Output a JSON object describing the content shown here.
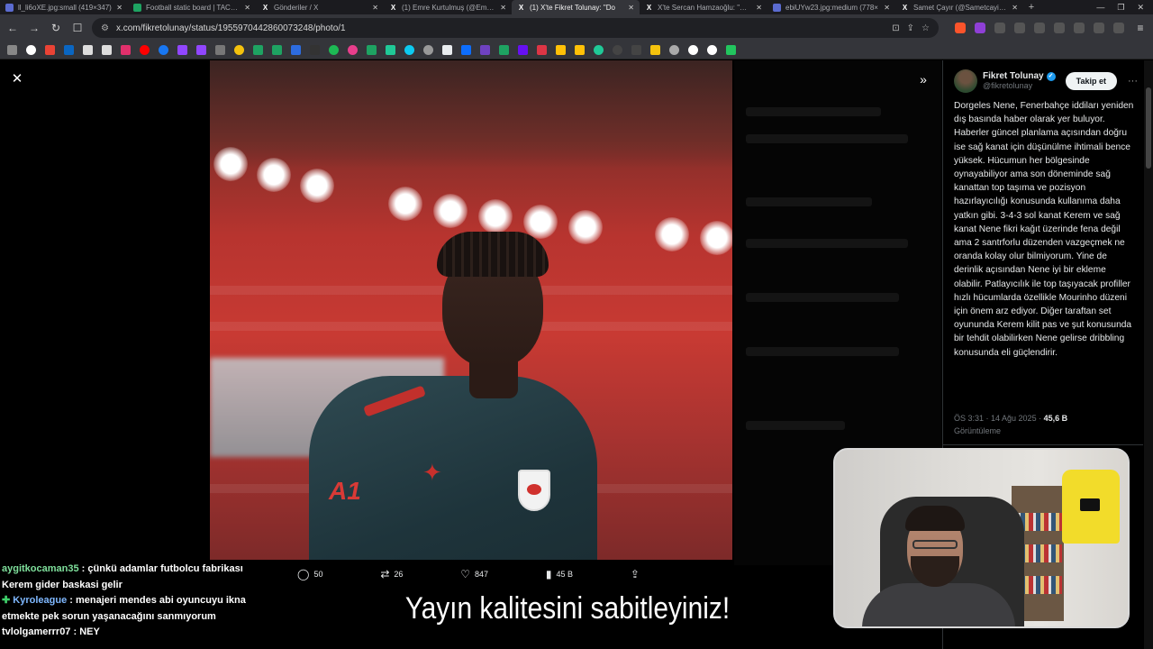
{
  "browser": {
    "tabs": [
      {
        "title": "ll_li6oXE.jpg:small (419×347)",
        "favicon": "img",
        "active": false
      },
      {
        "title": "Football static board | TACTIC",
        "favicon": "green",
        "active": false
      },
      {
        "title": "Gönderiler / X",
        "favicon": "x",
        "active": false
      },
      {
        "title": "(1) Emre Kurtulmuş (@Emrell",
        "favicon": "x",
        "active": false
      },
      {
        "title": "(1) X'te Fikret Tolunay: \"Do",
        "favicon": "x",
        "active": true
      },
      {
        "title": "X'te Sercan Hamzaoğlu: \"ÖZE",
        "favicon": "x",
        "active": false
      },
      {
        "title": "ebiUYw23.jpg:medium (778×",
        "favicon": "img",
        "active": false
      },
      {
        "title": "Samet Çayır (@Sametcayir) / X",
        "favicon": "x",
        "active": false
      }
    ],
    "new_tab": "+",
    "url": "x.com/fikretolunay/status/1955970442860073248/photo/1"
  },
  "viewer": {
    "close_label": "✕",
    "expand_label": "»",
    "actions": {
      "replies": "50",
      "reposts": "26",
      "likes": "847",
      "views": "45 B"
    }
  },
  "tweet": {
    "author_name": "Fikret Tolunay",
    "author_handle": "@fikretolunay",
    "follow_label": "Takip et",
    "text": "Dorgeles Nene, Fenerbahçe iddiları yeniden dış basında haber olarak yer buluyor. Haberler güncel planlama açısından doğru ise sağ kanat için düşünülme ihtimali bence yüksek. Hücumun her bölgesinde oynayabiliyor ama son döneminde sağ kanattan top taşıma ve pozisyon hazırlayıcılığı konusunda kullanıma daha yatkın gibi. 3-4-3 sol kanat Kerem ve sağ kanat Nene fikri kağıt üzerinde fena değil ama 2 santrforlu düzenden vazgeçmek ne oranda kolay olur bilmiyorum. Yine de derinlik açısından Nene iyi bir ekleme olabilir. Patlayıcılık ile top taşıyacak profiller hızlı hücumlarda özellikle Mourinho düzeni için önem arz ediyor. Diğer taraftan set oyununda Kerem kilit pas ve şut konusunda bir tehdit olabilirken Nene gelirse dribbling konusunda eli güçlendirir.",
    "timestamp": "ÖS 3:31 · 14 Ağu 2025 · ",
    "views_count": "45,6 B",
    "views_label": "Görüntüleme"
  },
  "stream": {
    "chat": [
      {
        "user": "aygitkocaman35",
        "separator": " : ",
        "message": "çünkü adamlar futbolcu fabrikası Kerem gider baskasi gelir"
      },
      {
        "user": "Kyroleague",
        "separator": " : ",
        "message": "menajeri mendes abi oyuncuyu ikna etmekte pek sorun yaşanacağını sanmıyorum"
      },
      {
        "user": "tvlolgamerrr07",
        "separator": " : ",
        "message": "NEY"
      }
    ],
    "banner": "Yayın kalitesini sabitleyiniz!"
  }
}
